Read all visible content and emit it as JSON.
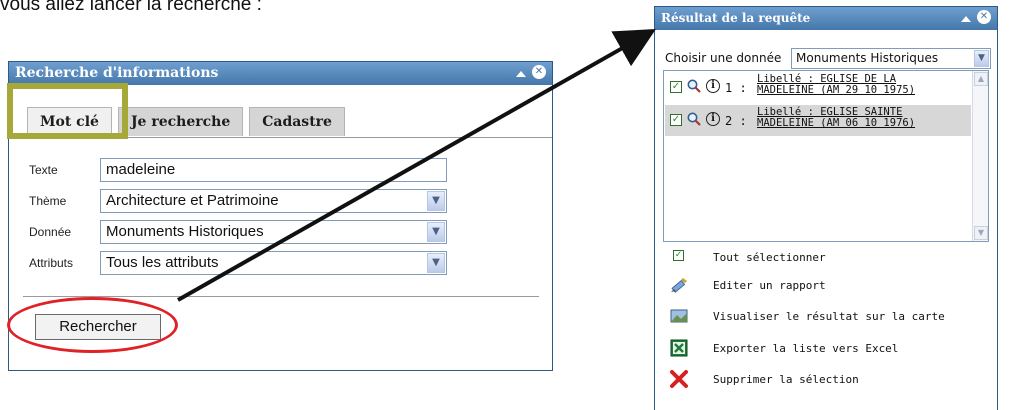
{
  "intro_text": "vous allez lancer la recherche :",
  "left_window": {
    "title": "Recherche d'informations",
    "tabs": [
      "Mot clé",
      "Je recherche",
      "Cadastre"
    ],
    "fields": [
      {
        "label": "Texte",
        "value": "madeleine",
        "kind": "input"
      },
      {
        "label": "Thème",
        "value": "Architecture et Patrimoine",
        "kind": "select"
      },
      {
        "label": "Donnée",
        "value": "Monuments Historiques",
        "kind": "select"
      },
      {
        "label": "Attributs",
        "value": "Tous les attributs",
        "kind": "select"
      }
    ],
    "search_button": "Rechercher"
  },
  "right_window": {
    "title": "Résultat de la requête",
    "choose_label": "Choisir une donnée",
    "choose_value": "Monuments Historiques",
    "results": [
      {
        "num": "1 :",
        "line1": "Libellé : EGLISE DE LA",
        "line2": "MADELEINE (AM 29 10 1975)",
        "selected": false
      },
      {
        "num": "2 :",
        "line1": "Libellé : EGLISE SAINTE",
        "line2": "MADELEINE (AM 06 10 1976)",
        "selected": true
      }
    ],
    "actions": [
      {
        "label": "Tout sélectionner",
        "icon": "checkbox-icon"
      },
      {
        "label": "Editer un rapport",
        "icon": "report-icon"
      },
      {
        "label": "Visualiser le résultat sur la carte",
        "icon": "map-view-icon"
      },
      {
        "label": "Exporter la liste vers Excel",
        "icon": "excel-icon"
      },
      {
        "label": "Supprimer la sélection",
        "icon": "delete-icon"
      }
    ]
  },
  "colors": {
    "titlebar": "#4577ab",
    "highlight": "#a6a83a",
    "annotation_red": "#e02227",
    "selected_row": "#d7d7d7"
  }
}
